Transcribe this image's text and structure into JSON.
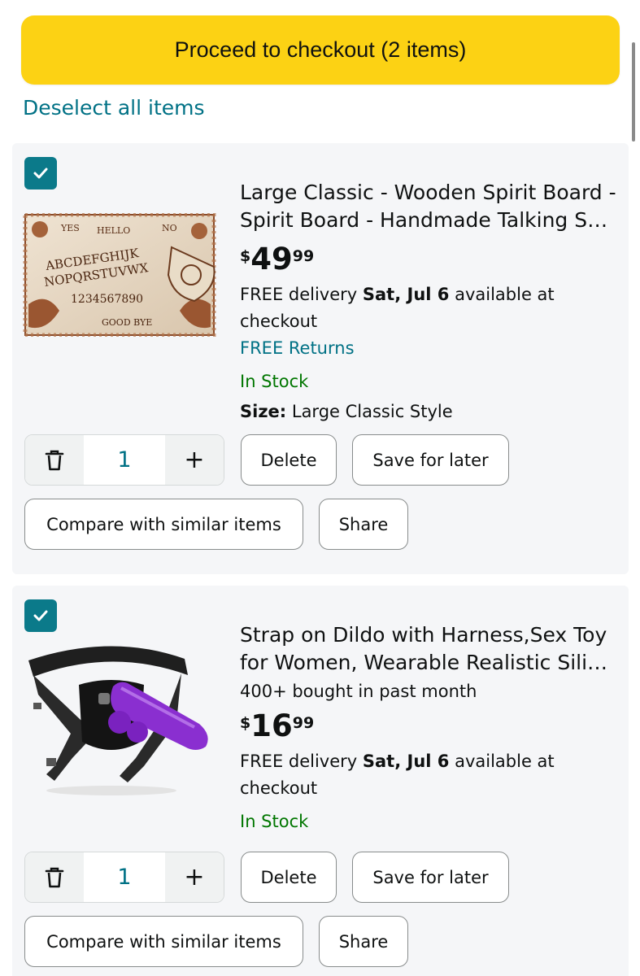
{
  "checkout_button_label": "Proceed to checkout (2 items)",
  "deselect_label": "Deselect all items",
  "colors": {
    "accent_yellow": "#fcd214",
    "link_teal": "#007185",
    "stock_green": "#007600",
    "checkbox_teal": "#0b7a8a"
  },
  "items": [
    {
      "title": "Large Classic - Wooden Spirit Board - Spirit Board - Handmade Talking S…",
      "price": {
        "currency": "$",
        "dollars": "49",
        "cents": "99"
      },
      "delivery": {
        "prefix": "FREE delivery ",
        "date": "Sat, Jul 6",
        "suffix": " available at checkout"
      },
      "returns": "FREE Returns",
      "stock": "In Stock",
      "size_label": "Size:",
      "size_value": " Large Classic Style",
      "quantity": "1",
      "thumbnail_text": {
        "yes": "YES",
        "hello": "HELLO",
        "no": "NO",
        "row1": "ABCDEFGHIJK",
        "row2": "NOPQRSTUVWX",
        "numbers": "1234567890",
        "goodbye": "GOOD BYE"
      },
      "delete_label": "Delete",
      "save_label": "Save for later",
      "compare_label": "Compare with similar items",
      "share_label": "Share"
    },
    {
      "title": "Strap on Dildo with Harness,Sex Toy for Women, Wearable Realistic Sili…",
      "bought": "400+ bought in past month",
      "price": {
        "currency": "$",
        "dollars": "16",
        "cents": "99"
      },
      "delivery": {
        "prefix": "FREE delivery ",
        "date": "Sat, Jul 6",
        "suffix": " available at checkout"
      },
      "stock": "In Stock",
      "quantity": "1",
      "delete_label": "Delete",
      "save_label": "Save for later",
      "compare_label": "Compare with similar items",
      "share_label": "Share"
    }
  ]
}
